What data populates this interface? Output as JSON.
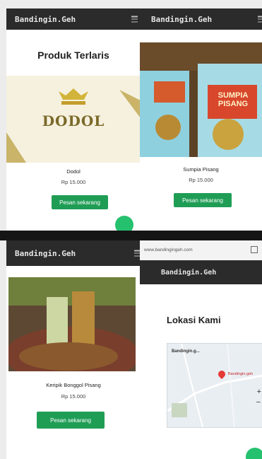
{
  "brand": "Bandingin.Geh",
  "section_titles": {
    "products": "Produk Terlaris",
    "location": "Lokasi Kami"
  },
  "products": [
    {
      "name": "Dodol",
      "price": "Rp 15.000",
      "button": "Pesan sekarang",
      "logo_text": "DODOL"
    },
    {
      "name": "Sumpia Pisang",
      "price": "Rp 15.000",
      "button": "Pesan sekarang",
      "package_text": "SUMPIA PISANG"
    },
    {
      "name": "Keripik Bonggol Pisang",
      "price": "Rp 15.000",
      "button": "Pesan sekarang"
    }
  ],
  "browser": {
    "url": "www.bandingingeh.com"
  },
  "map": {
    "place": "Bandingin.g...",
    "marker_label": "Bandingin.geh"
  },
  "colors": {
    "nav": "#2b2b2b",
    "button": "#1f9d55",
    "fab": "#25c16f"
  }
}
